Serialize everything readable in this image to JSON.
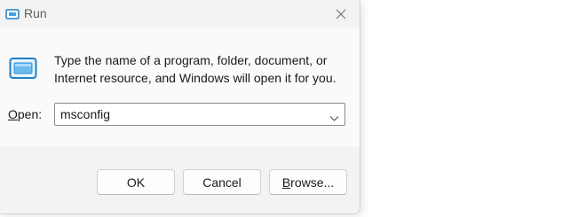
{
  "window": {
    "title": "Run",
    "title_icon": "run-icon",
    "close_icon": "close-icon"
  },
  "body": {
    "icon": "run-app-icon",
    "description": "Type the name of a program, folder, document, or Internet resource, and Windows will open it for you."
  },
  "open_field": {
    "label_mnemonic": "O",
    "label_rest": "pen:",
    "value": "msconfig",
    "dropdown_icon": "chevron-down-icon"
  },
  "buttons": {
    "ok_label": "OK",
    "cancel_label": "Cancel",
    "browse_mnemonic": "B",
    "browse_rest": "rowse..."
  },
  "colors": {
    "accent": "#0078d4",
    "dialog_bg": "#f3f3f3",
    "content_bg": "#fafafa"
  }
}
